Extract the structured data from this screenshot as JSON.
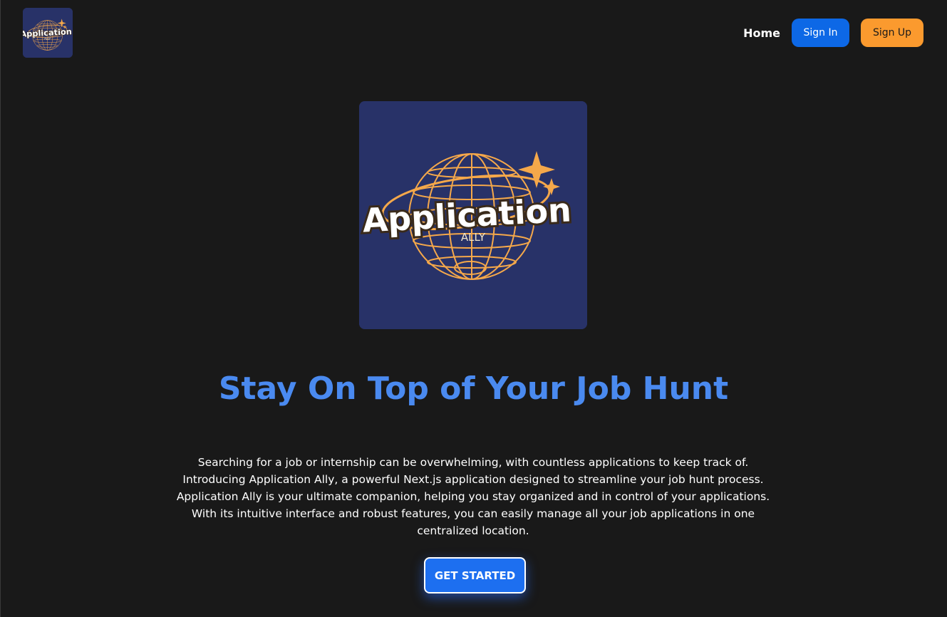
{
  "brand": {
    "logo_wordmark": "Application",
    "logo_subtitle": "ALLY"
  },
  "nav": {
    "home_label": "Home",
    "signin_label": "Sign In",
    "signup_label": "Sign Up"
  },
  "hero": {
    "headline": "Stay On Top of Your Job Hunt",
    "intro": "Searching for a job or internship can be overwhelming, with countless applications to keep track of. Introducing Application Ally, a powerful Next.js application designed to streamline your job hunt process. Application Ally is your ultimate companion, helping you stay organized and in control of your applications. With its intuitive interface and robust features, you can easily manage all your job applications in one centralized location.",
    "cta_label": "GET STARTED"
  },
  "colors": {
    "background": "#191919",
    "logo_bg": "#283268",
    "logo_gold": "#f5a84a",
    "headline": "#4a8af0",
    "signin": "#0d68e6",
    "signup": "#fb9a2e",
    "cta": "#1d6ff0"
  }
}
